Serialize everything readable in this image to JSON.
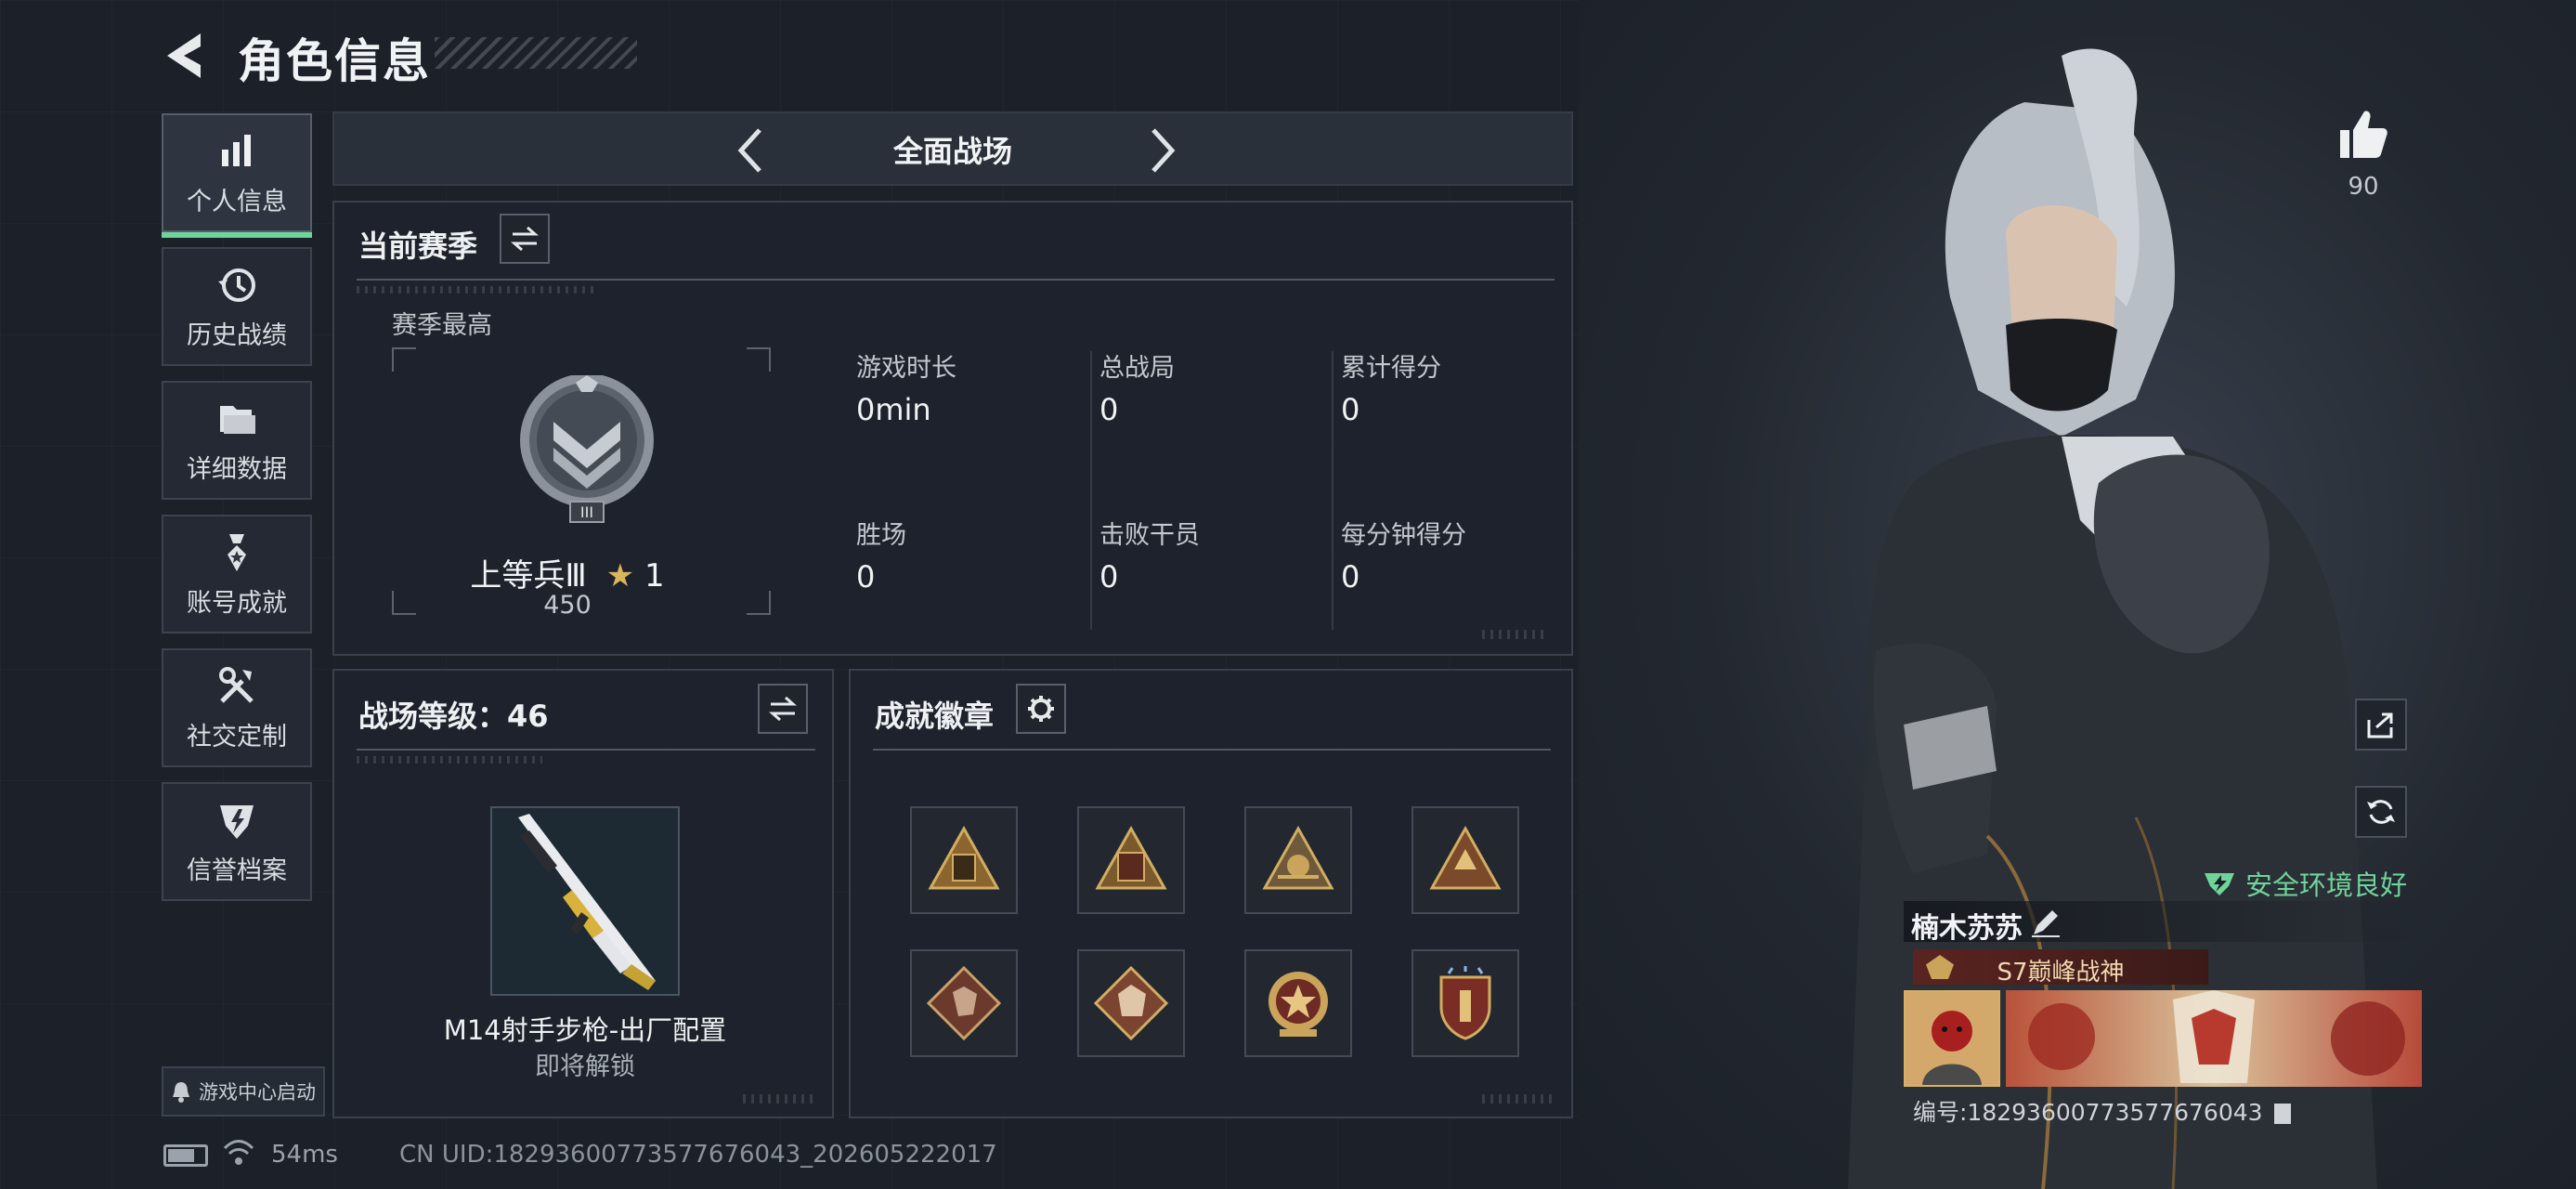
{
  "header": {
    "title": "角色信息"
  },
  "sidebar": {
    "items": [
      {
        "label": "个人信息",
        "icon": "bar-chart-icon",
        "active": true
      },
      {
        "label": "历史战绩",
        "icon": "clock-history-icon"
      },
      {
        "label": "详细数据",
        "icon": "folder-icon"
      },
      {
        "label": "账号成就",
        "icon": "medal-icon"
      },
      {
        "label": "社交定制",
        "icon": "tools-icon"
      },
      {
        "label": "信誉档案",
        "icon": "shield-badge-icon"
      }
    ],
    "game_center": "游戏中心启动"
  },
  "mode_selector": {
    "label": "全面战场"
  },
  "season": {
    "title": "当前赛季",
    "best_label": "赛季最高",
    "rank_name": "上等兵Ⅲ",
    "rank_stars": "1",
    "rank_score": "450",
    "rank_roman": "III",
    "stats": [
      {
        "label": "游戏时长",
        "value": "0min"
      },
      {
        "label": "总战局",
        "value": "0"
      },
      {
        "label": "累计得分",
        "value": "0"
      },
      {
        "label": "胜场",
        "value": "0"
      },
      {
        "label": "击败干员",
        "value": "0"
      },
      {
        "label": "每分钟得分",
        "value": "0"
      }
    ]
  },
  "battlefield_level": {
    "title": "战场等级：46",
    "weapon_name": "M14射手步枪-出厂配置",
    "weapon_status": "即将解锁"
  },
  "achievements": {
    "title": "成就徽章",
    "badges": [
      "badge-1",
      "badge-2",
      "badge-3",
      "badge-4",
      "badge-5",
      "badge-6",
      "badge-7",
      "badge-8"
    ]
  },
  "likes": {
    "count": "90"
  },
  "safety": {
    "text": "安全环境良好"
  },
  "profile": {
    "name": "楠木苏苏",
    "title_badge": "S7巅峰战神",
    "id_text": "编号:18293600773577676043"
  },
  "status_bar": {
    "ping": "54ms",
    "uid": "CN UID:18293600773577676043_202605222017"
  },
  "colors": {
    "accent_green": "#6fd49a",
    "gold": "#c9a45a",
    "background": "#1b2029"
  }
}
